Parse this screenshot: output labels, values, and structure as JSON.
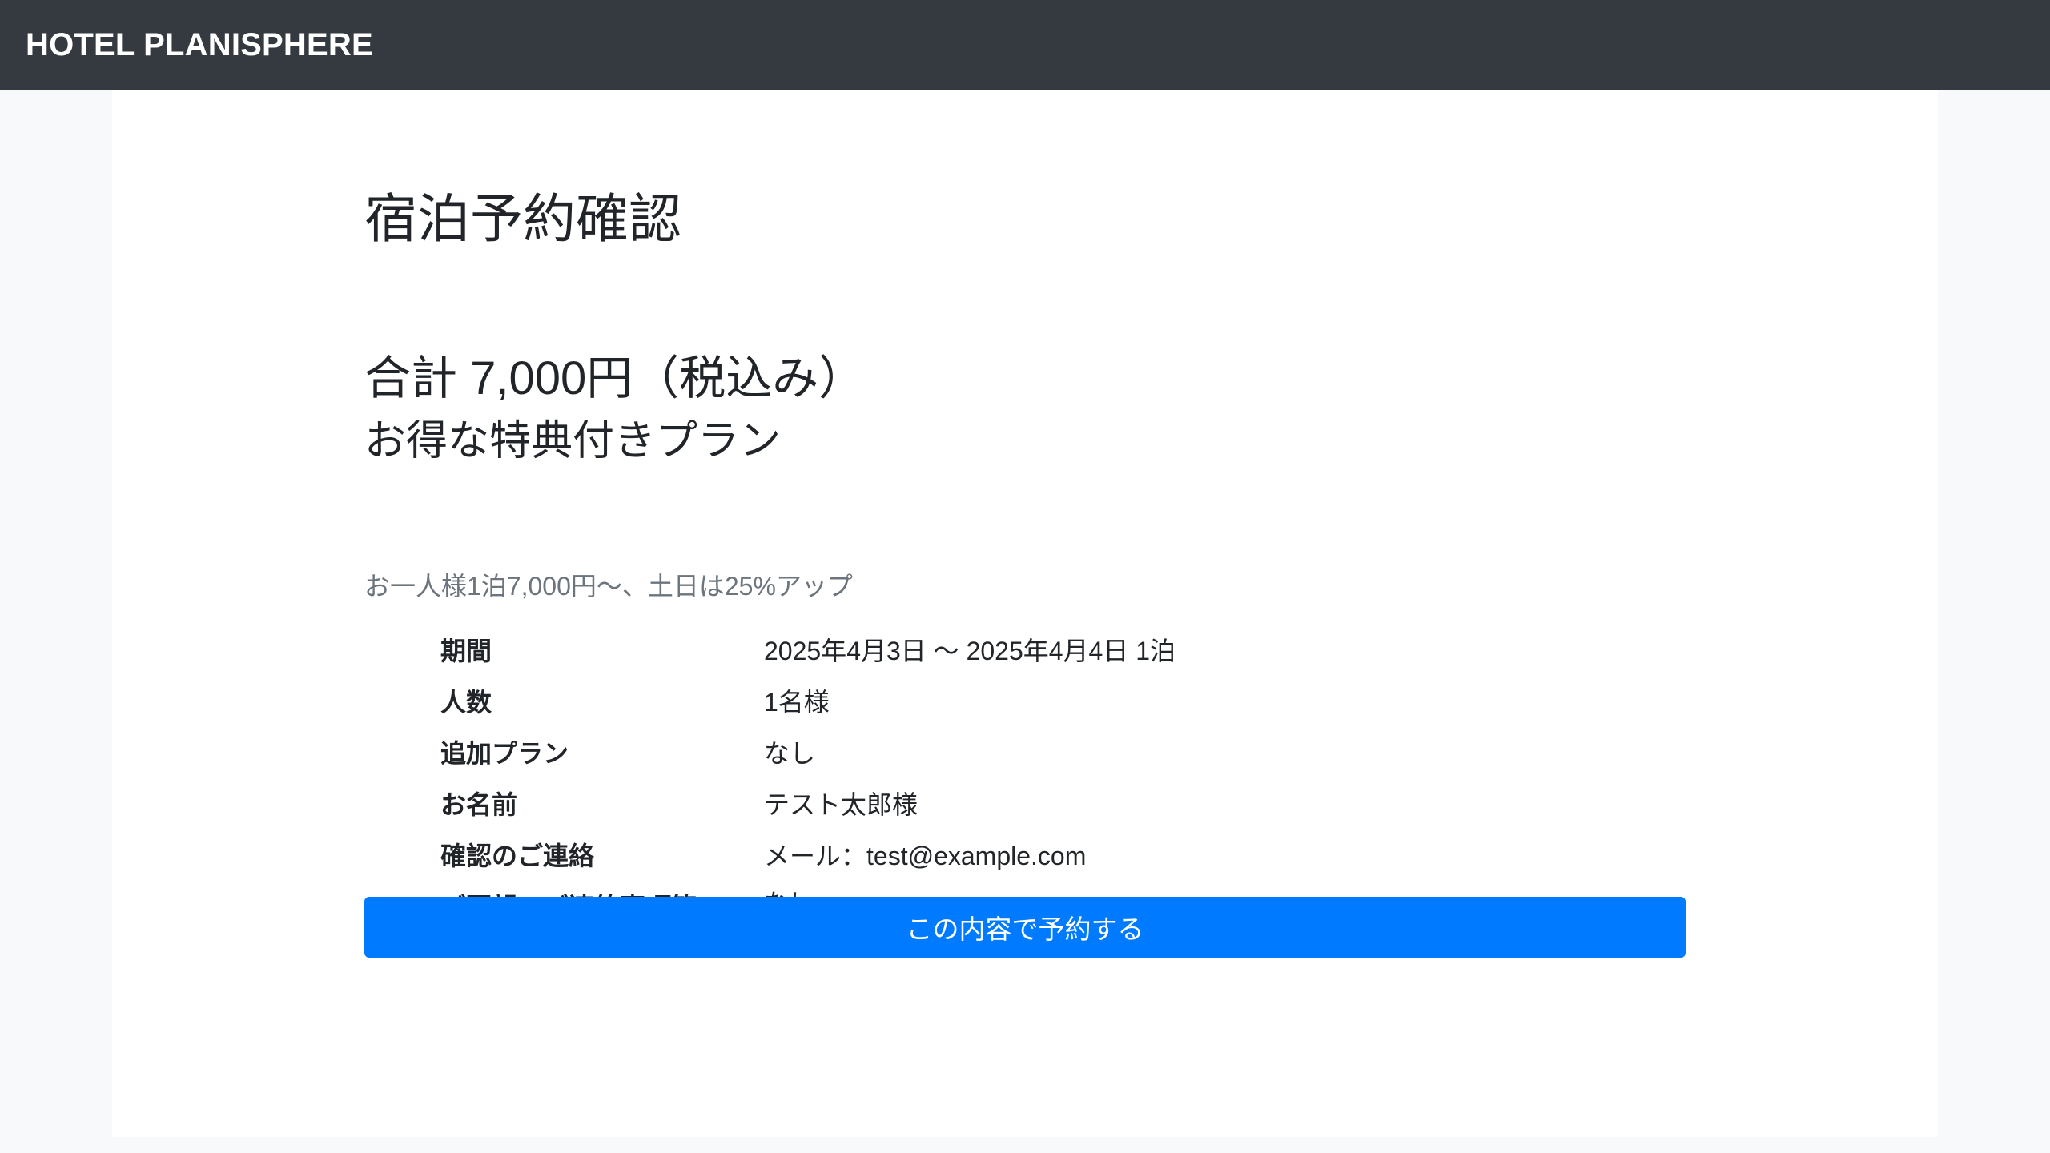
{
  "navbar": {
    "brand": "HOTEL PLANISPHERE"
  },
  "page": {
    "title": "宿泊予約確認"
  },
  "summary": {
    "total": "合計 7,000円（税込み）",
    "plan_name": "お得な特典付きプラン",
    "plan_description": "お一人様1泊7,000円〜、土日は25%アップ"
  },
  "details": [
    {
      "label": "期間",
      "value": "2025年4月3日 〜 2025年4月4日 1泊"
    },
    {
      "label": "人数",
      "value": "1名様"
    },
    {
      "label": "追加プラン",
      "value": "なし"
    },
    {
      "label": "お名前",
      "value": "テスト太郎様"
    },
    {
      "label": "確認のご連絡",
      "value": "メール：test@example.com"
    },
    {
      "label": "ご要望・ご連絡事項等",
      "value": "なし"
    }
  ],
  "actions": {
    "submit_label": "この内容で予約する"
  },
  "colors": {
    "navbar_bg": "#343a40",
    "primary": "#007bff",
    "muted_text": "#6c757d",
    "page_bg": "#f8f9fa"
  }
}
